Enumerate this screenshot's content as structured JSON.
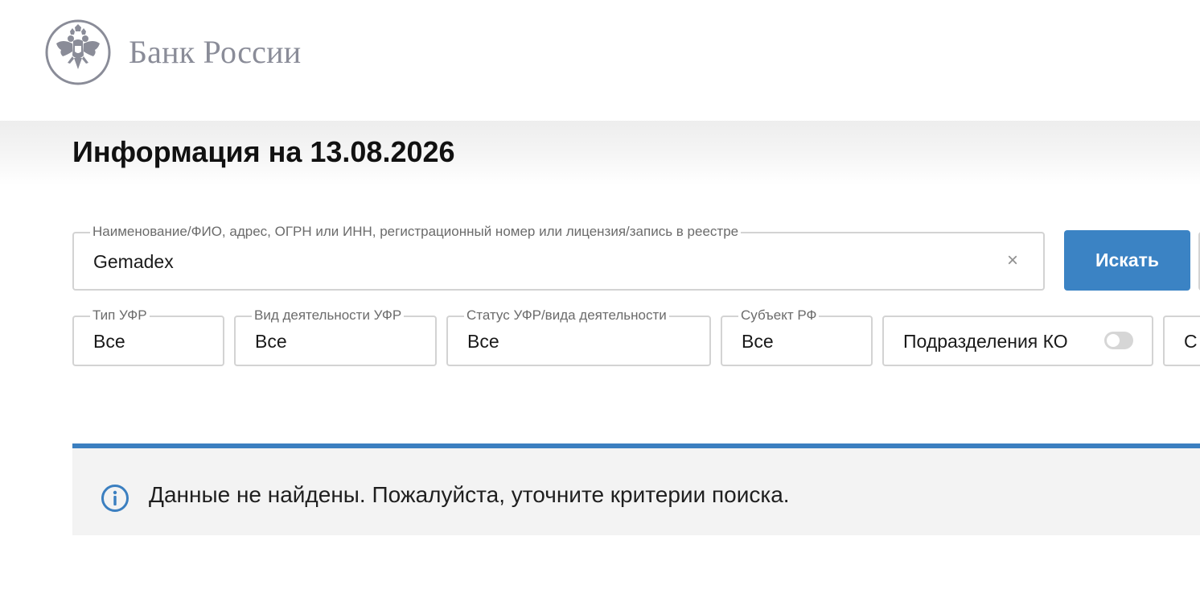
{
  "header": {
    "logo_text": "Банк России"
  },
  "page": {
    "title": "Информация на 13.08.2026"
  },
  "search": {
    "label": "Наименование/ФИО, адрес, ОГРН или ИНН, регистрационный номер или лицензия/запись в реестре",
    "value": "Gemadex",
    "clear_icon": "close-icon",
    "button_label": "Искать"
  },
  "filters": {
    "type": {
      "label": "Тип УФР",
      "value": "Все"
    },
    "activity": {
      "label": "Вид деятельности УФР",
      "value": "Все"
    },
    "status": {
      "label": "Статус УФР/вида деятельности",
      "value": "Все"
    },
    "region": {
      "label": "Субъект РФ",
      "value": "Все"
    },
    "branches": {
      "label": "Подразделения КО",
      "toggle_on": false
    },
    "partial": {
      "value": "С"
    }
  },
  "notice": {
    "icon": "info-icon",
    "text": "Данные не найдены. Пожалуйста, уточните критерии поиска."
  },
  "colors": {
    "accent": "#3b83c4",
    "notice_border": "#3b7fc0",
    "logo_gray": "#8a8c98"
  }
}
